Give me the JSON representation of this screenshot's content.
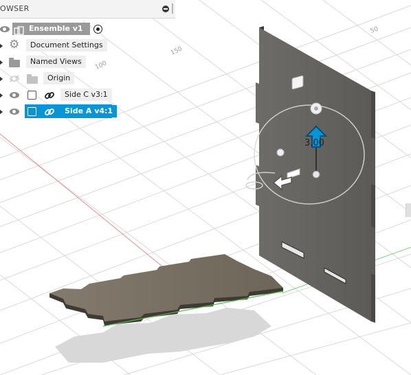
{
  "browser": {
    "title": "OWSER",
    "collapse_icon": "minus-circle-icon",
    "pin_icon": "pin-bar-icon",
    "root": {
      "label": "Ensemble v1",
      "icon": "assembly-component-icon",
      "visible": true,
      "active": true
    },
    "items": [
      {
        "label": "Document Settings",
        "icon": "gear-icon",
        "eye": false
      },
      {
        "label": "Named Views",
        "icon": "folder-icon",
        "eye": false
      },
      {
        "label": "Origin",
        "icon": "folder-icon",
        "eye": "hidden"
      },
      {
        "label": "Side C v3:1",
        "icon": "link-icon",
        "eye": true
      },
      {
        "label": "Side A v4:1",
        "icon": "link-icon",
        "eye": true,
        "selected": true
      }
    ]
  },
  "viewport": {
    "grid_labels": [
      "150",
      "100",
      "50",
      "50"
    ],
    "dimension_label": "3.00",
    "selected_color": "#0696d7",
    "part_color": "#6b6a66",
    "plate_color": "#6e675b",
    "manipulator": {
      "move_arrow": "blue-up-arrow-icon",
      "side_arrow": "white-left-arrow-icon"
    }
  }
}
